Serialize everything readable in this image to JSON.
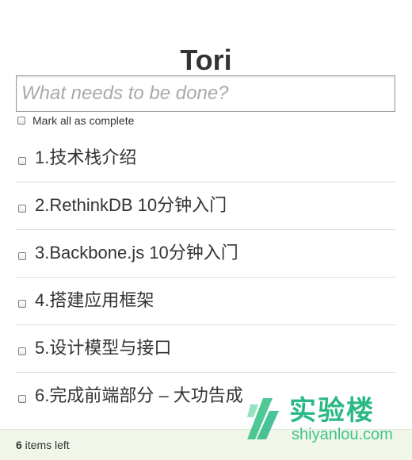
{
  "header": {
    "title": "Tori"
  },
  "new_todo": {
    "placeholder": "What needs to be done?",
    "value": ""
  },
  "toggle_all": {
    "label": "Mark all as complete",
    "checked": false
  },
  "todos": [
    {
      "text": "1.技术栈介绍",
      "completed": false
    },
    {
      "text": "2.RethinkDB 10分钟入门",
      "completed": false
    },
    {
      "text": "3.Backbone.js 10分钟入门",
      "completed": false
    },
    {
      "text": "4.搭建应用框架",
      "completed": false
    },
    {
      "text": "5.设计模型与接口",
      "completed": false
    },
    {
      "text": "6.完成前端部分 – 大功告成",
      "completed": false
    }
  ],
  "footer": {
    "count": "6",
    "count_suffix": " items left"
  },
  "watermark": {
    "name": "实验楼",
    "domain": "shiyanlou.com",
    "color": "#19b37b"
  }
}
